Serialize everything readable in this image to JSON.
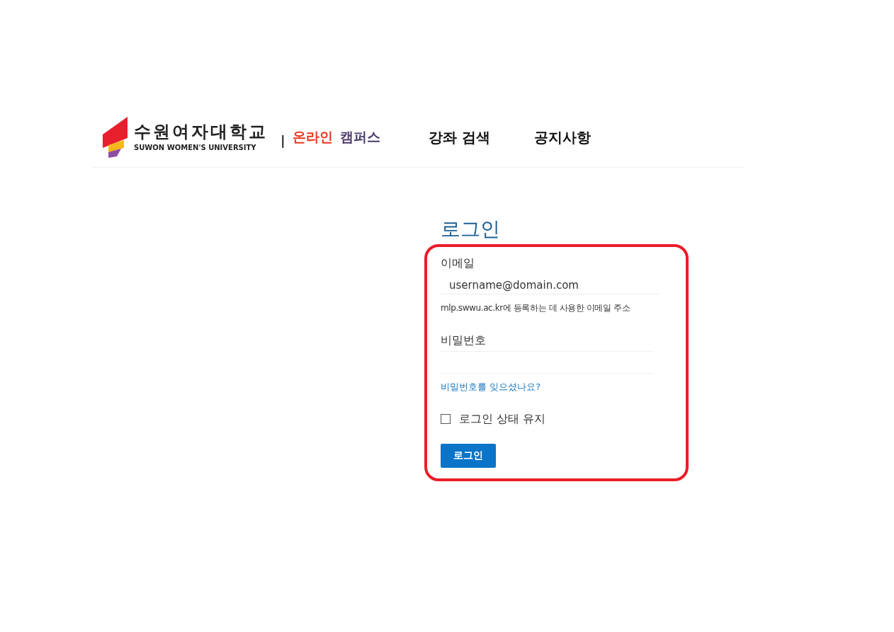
{
  "header": {
    "logo": {
      "name_ko": "수원여자대학교",
      "name_en": "SUWON WOMEN'S UNIVERSITY"
    },
    "separator": "|",
    "site_title": [
      {
        "text": "온라인",
        "color": "#e8361f"
      },
      {
        "text": "캠퍼스",
        "color": "#4b3a6b"
      }
    ],
    "nav": [
      {
        "label": "강좌 검색"
      },
      {
        "label": "공지사항"
      }
    ]
  },
  "login": {
    "title": "로그인",
    "highlighted": true,
    "email": {
      "label": "이메일",
      "placeholder": "username@domain.com",
      "hint": "mlp.swwu.ac.kr에 등록하는 데 사용한 이메일 주소"
    },
    "password": {
      "label": "비밀번호"
    },
    "forgot_link": "비밀번호를 잊으셨나요?",
    "remember": {
      "label": "로그인 상태 유지",
      "checked": false
    },
    "submit": "로그인"
  }
}
